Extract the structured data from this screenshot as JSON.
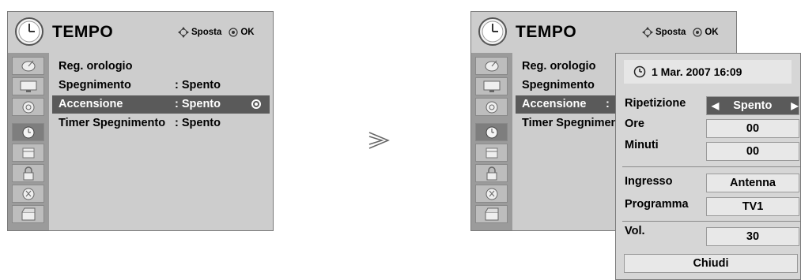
{
  "left_menu": {
    "title": "TEMPO",
    "nav_move_label": "Sposta",
    "nav_ok_label": "OK",
    "sidebar_icons": [
      "antenna-dish-icon",
      "monitor-icon",
      "speaker-icon",
      "clock-icon",
      "calendar-icon",
      "padlock-icon",
      "satellite-icon",
      "clapperboard-icon"
    ],
    "active_icon_index": 3,
    "rows": [
      {
        "label": "Reg. orologio",
        "value": ""
      },
      {
        "label": "Spegnimento",
        "value": ": Spento"
      },
      {
        "label": "Accensione",
        "value": ": Spento"
      },
      {
        "label": "Timer Spegnimento",
        "value": ": Spento"
      }
    ],
    "selected_row": 2
  },
  "arrow_glyph": "≫",
  "right_menu": {
    "title": "TEMPO",
    "nav_move_label": "Sposta",
    "nav_ok_label": "OK",
    "rows": [
      {
        "label": "Reg. orologio",
        "value": ""
      },
      {
        "label": "Spegnimento",
        "value": ""
      },
      {
        "label": "Accensione",
        "value": ":"
      },
      {
        "label": "Timer Spegnimen",
        "value": ""
      }
    ],
    "selected_row": 2
  },
  "popup": {
    "datetime": "1 Mar. 2007 16:09",
    "repeat_label": "Ripetizione",
    "repeat_value": "Spento",
    "hours_label": "Ore",
    "hours_value": "00",
    "minutes_label": "Minuti",
    "minutes_value": "00",
    "input_label": "Ingresso",
    "input_value": "Antenna",
    "program_label": "Programma",
    "program_value": "TV1",
    "volume_label": "Vol.",
    "volume_value": "30",
    "close_label": "Chiudi"
  },
  "colors": {
    "panel_bg": "#cdcdcd",
    "sidebar_bg": "#9b9b9b",
    "selected_bg": "#5a5a5a",
    "popup_bg": "#d6d6d6"
  }
}
